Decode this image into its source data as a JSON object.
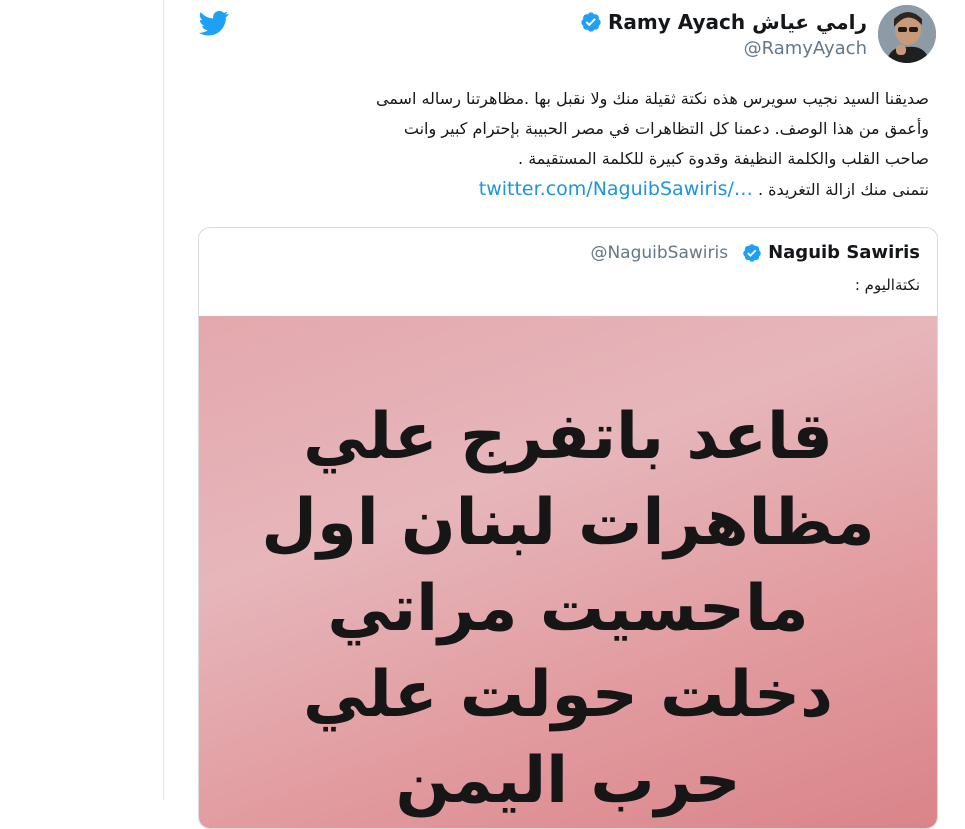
{
  "author": {
    "display_name": "Ramy Ayach رامي عياش",
    "handle": "@RamyAyach"
  },
  "tweet": {
    "text_lines": [
      "صديقنا السيد نجيب سويرس هذه نكتة ثقيلة منك ولا نقبل بها .مظاهرتنا رساله اسمى",
      "وأعمق من هذا الوصف. دعمنا كل التظاهرات في مصر الحبيبة بإحترام كبير وانت",
      "صاحب القلب والكلمة النظيفة وقدوة كبيرة للكلمة المستقيمة ."
    ],
    "last_line_text": "نتمنى منك ازالة التغريدة . ",
    "link_text": "twitter.com/NaguibSawiris/…"
  },
  "quoted_tweet": {
    "display_name": "Naguib Sawiris",
    "handle": "@NaguibSawiris",
    "text": "نكتةاليوم :",
    "image_lines": [
      "قاعد باتفرج علي",
      "مظاهرات لبنان اول",
      "ماحسيت مراتي",
      "دخلت حولت علي",
      "حرب اليمن"
    ]
  },
  "icons": {
    "brand": "twitter-bird-icon",
    "verified": "verified-badge-icon"
  },
  "colors": {
    "twitter_blue": "#1da1f2",
    "link": "#1b95e0",
    "muted": "#657786"
  }
}
